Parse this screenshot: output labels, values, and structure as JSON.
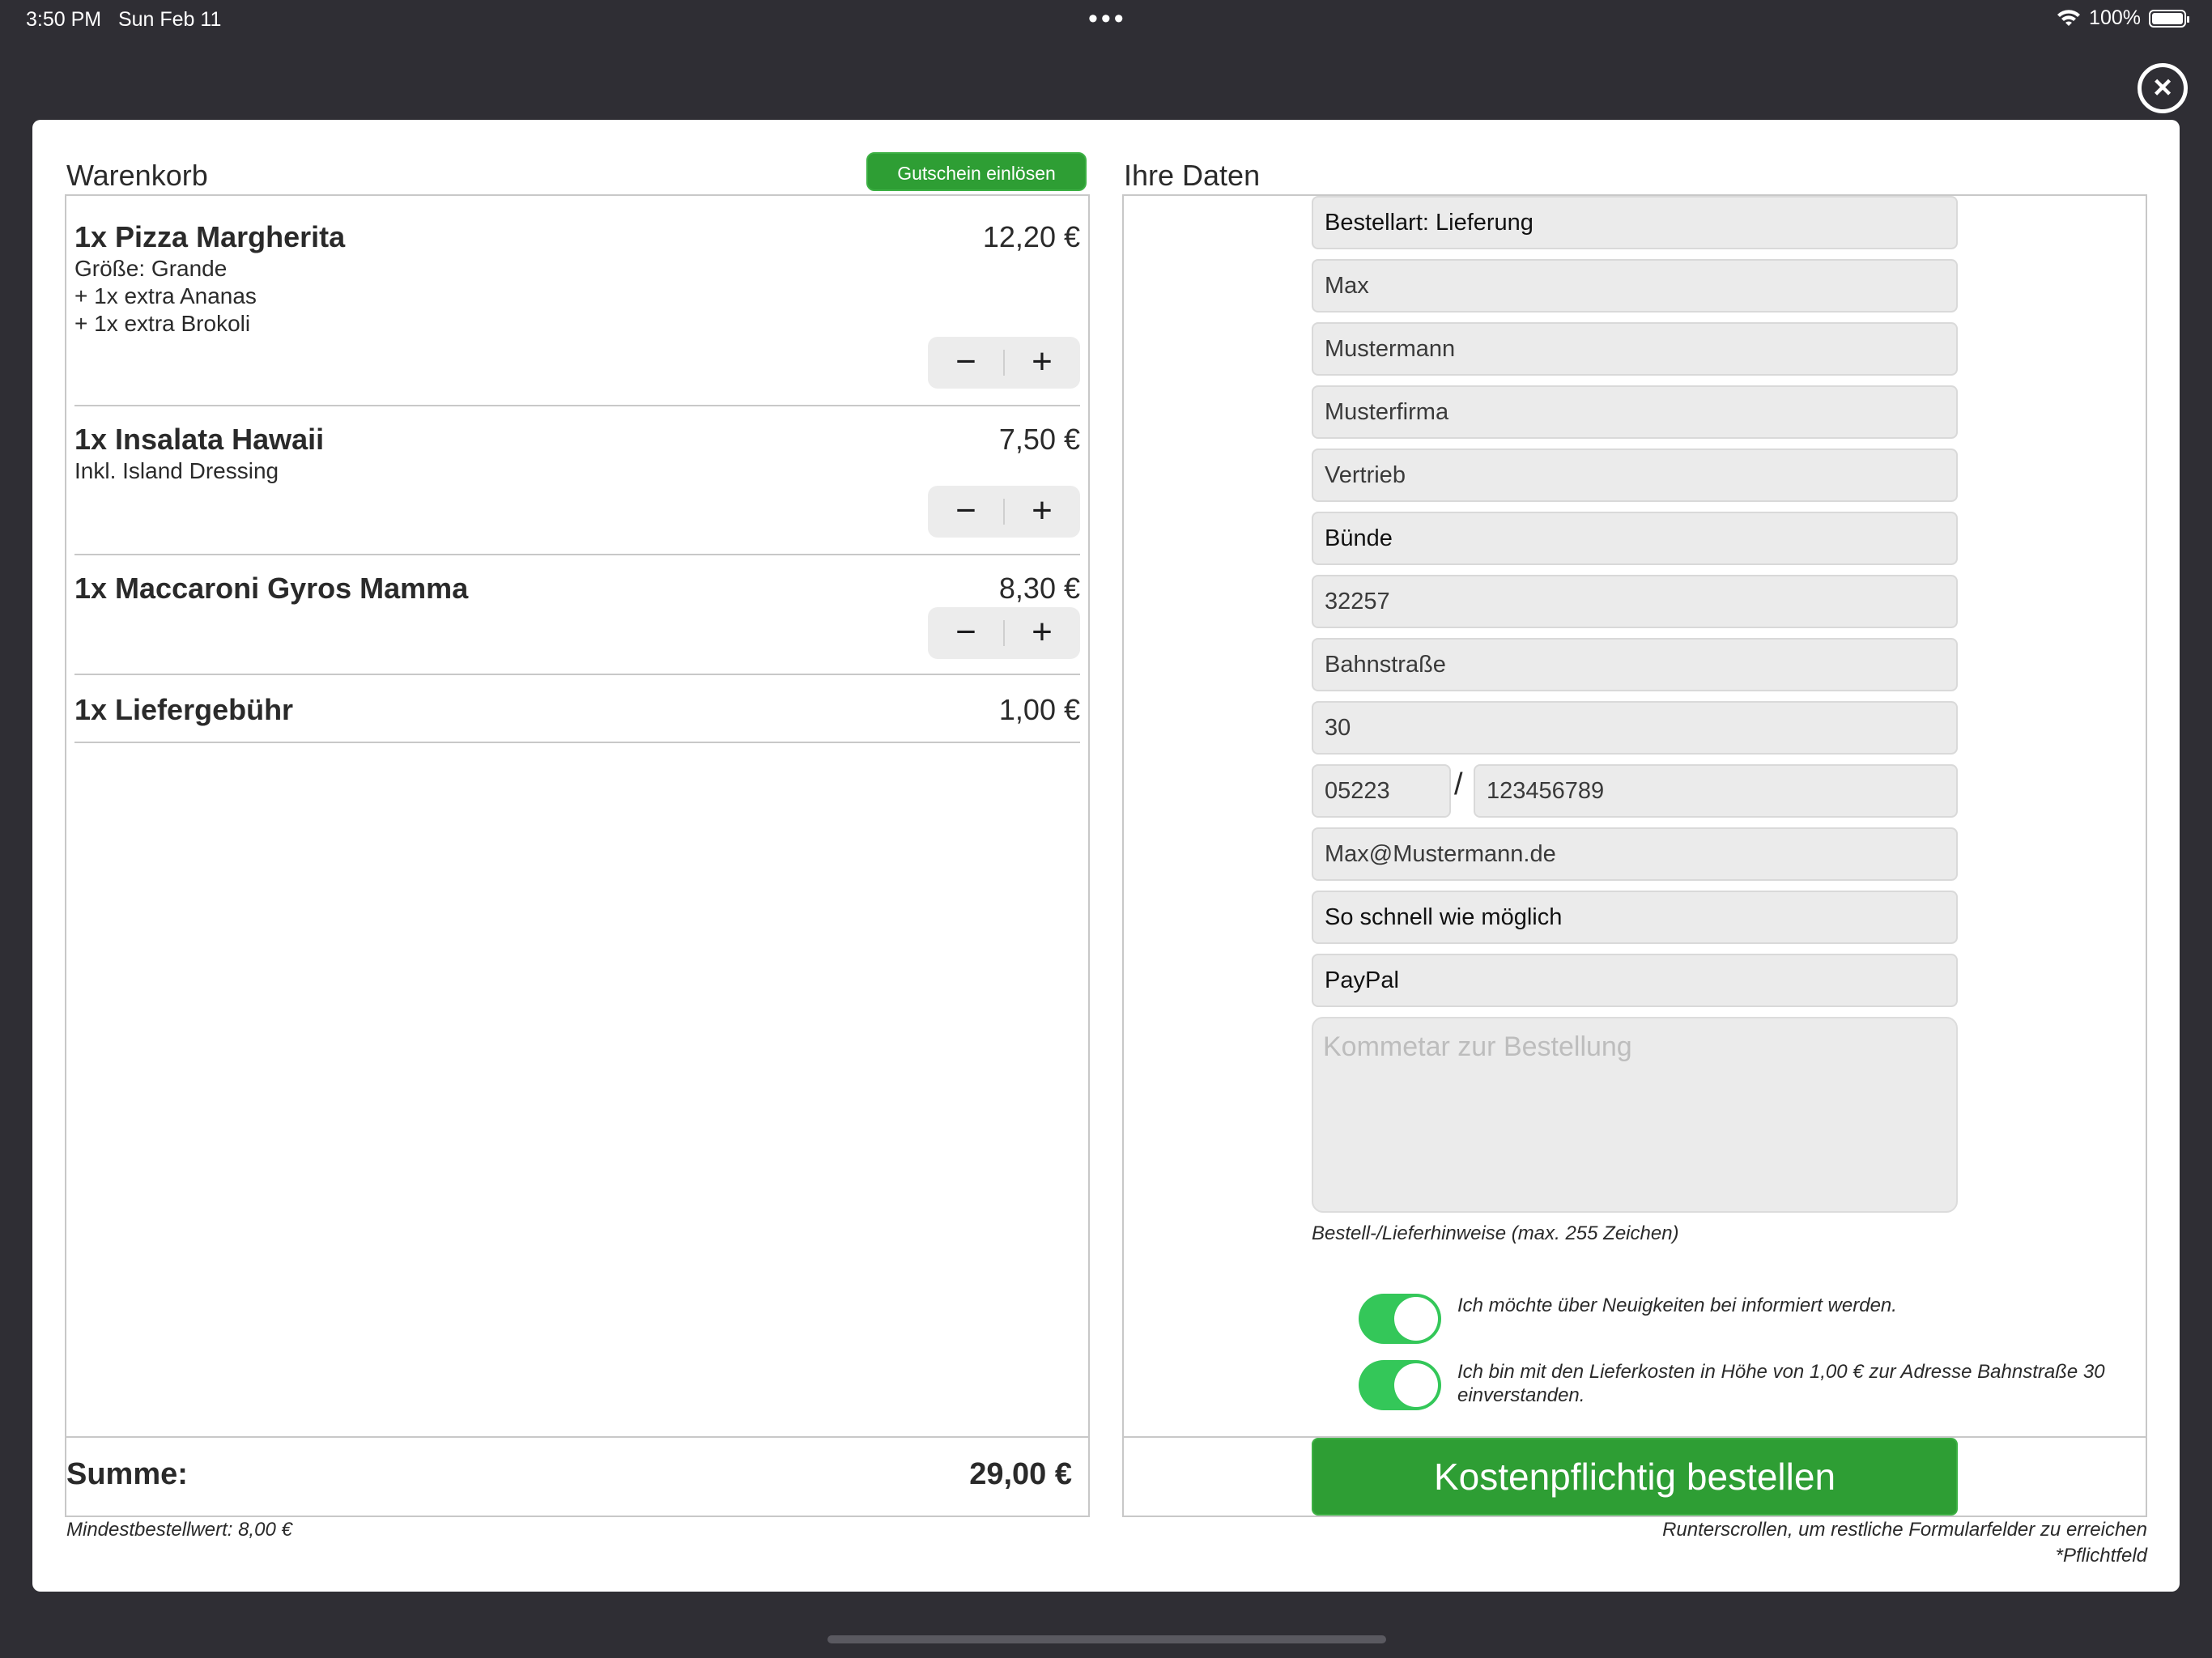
{
  "status_bar": {
    "time": "3:50 PM",
    "date": "Sun Feb 11",
    "dots": "•••",
    "battery": "100%",
    "wifi_icon": "wifi-icon",
    "battery_icon": "battery-icon"
  },
  "close_icon": "close-circle-icon",
  "cart": {
    "title": "Warenkorb",
    "voucher_button": "Gutschein einlösen",
    "items": [
      {
        "name": "1x Pizza Margherita",
        "price": "12,20 €",
        "details": [
          "Größe: Grande",
          "+ 1x extra Ananas",
          "+ 1x extra Brokoli"
        ]
      },
      {
        "name": "1x Insalata Hawaii",
        "price": "7,50 €",
        "details": [
          "Inkl. Island Dressing"
        ]
      },
      {
        "name": "1x Maccaroni Gyros Mamma",
        "price": "8,30 €",
        "details": []
      },
      {
        "name": "1x Liefergebühr",
        "price": "1,00 €",
        "details": []
      }
    ],
    "stepper_minus": "−",
    "stepper_plus": "+",
    "sum_label": "Summe:",
    "sum_value": "29,00 €",
    "min_order": "Mindestbestellwert: 8,00 €"
  },
  "form": {
    "title": "Ihre Daten",
    "order_type": "Bestellart: Lieferung",
    "first_name": "Max",
    "last_name": "Mustermann",
    "company": "Musterfirma",
    "department": "Vertrieb",
    "city": "Bünde",
    "zip": "32257",
    "street": "Bahnstraße",
    "house_number": "30",
    "phone_prefix": "05223",
    "phone_separator": "/",
    "phone_number": "123456789",
    "email": "Max@Mustermann.de",
    "delivery_time": "So schnell wie möglich",
    "payment": "PayPal",
    "comment_placeholder": "Kommetar zur Bestellung",
    "comment_hint": "Bestell-/Lieferhinweise (max. 255 Zeichen)",
    "toggle_newsletter": "Ich möchte über Neuigkeiten bei informiert werden.",
    "toggle_delivery_line1": "Ich bin mit den Lieferkosten in Höhe von 1,00 € zur Adresse Bahnstraße 30",
    "toggle_delivery_line2": "einverstanden.",
    "order_button": "Kostenpflichtig bestellen",
    "scroll_hint": "Runterscrollen, um restliche Formularfelder zu erreichen",
    "required_hint": "*Pflichtfeld"
  },
  "colors": {
    "accent_green": "#2e9e34",
    "toggle_green": "#34c759",
    "backdrop": "#2f2e34"
  }
}
